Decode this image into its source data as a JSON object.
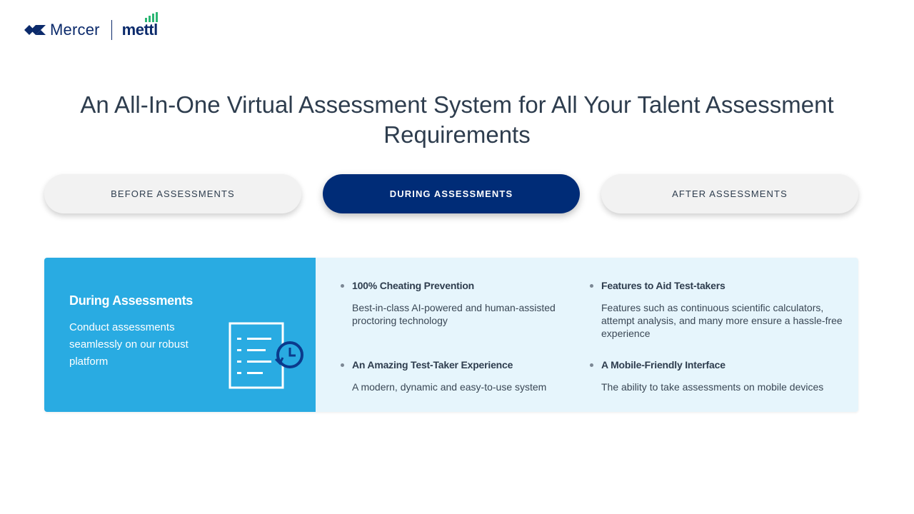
{
  "header": {
    "brand_primary": "Mercer",
    "brand_secondary": "mettl"
  },
  "title": "An All-In-One Virtual Assessment System for All Your Talent Assessment Requirements",
  "tabs": [
    {
      "label": "BEFORE ASSESSMENTS",
      "active": false
    },
    {
      "label": "DURING ASSESSMENTS",
      "active": true
    },
    {
      "label": "AFTER ASSESSMENTS",
      "active": false
    }
  ],
  "panel": {
    "heading": "During Assessments",
    "description": "Conduct assessments seamlessly on our robust platform",
    "icon": "checklist-clock-icon",
    "features": [
      {
        "title": "100% Cheating Prevention",
        "description": "Best-in-class AI-powered and human-assisted proctoring technology"
      },
      {
        "title": "Features to Aid Test-takers",
        "description": "Features such as continuous scientific calculators, attempt analysis, and many more ensure a hassle-free experience"
      },
      {
        "title": "An Amazing Test-Taker Experience",
        "description": "A modern, dynamic and easy-to-use system"
      },
      {
        "title": "A Mobile-Friendly Interface",
        "description": "The ability to take assessments on mobile devices"
      }
    ]
  },
  "colors": {
    "brand_navy": "#002c77",
    "panel_blue": "#29abe2",
    "panel_light": "#e6f5fc",
    "tab_inactive": "#f2f2f2"
  }
}
